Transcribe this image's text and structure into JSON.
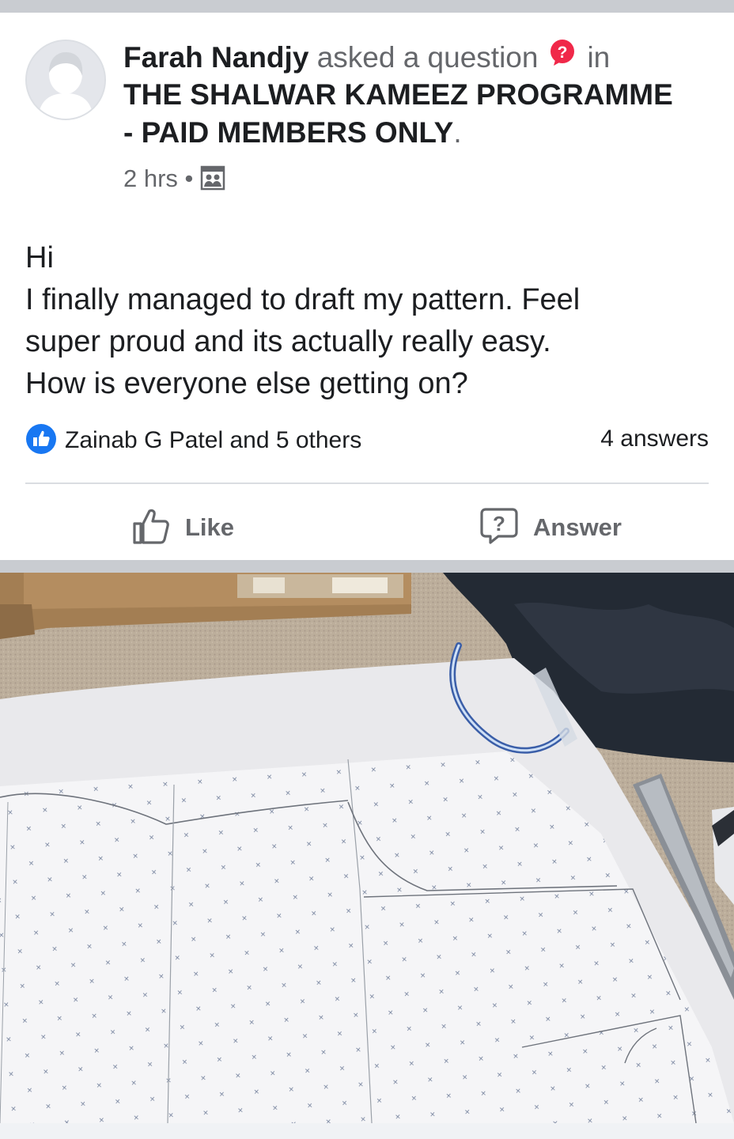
{
  "post": {
    "author": "Farah Nandjy",
    "action_text": "asked a question",
    "in_text": "in",
    "group_line1": "THE SHALWAR KAMEEZ PROGRAMME",
    "group_line2": "- PAID MEMBERS ONLY",
    "group_period": ".",
    "timestamp": "2 hrs",
    "dot": "•",
    "privacy_icon": "group-icon",
    "body_lines": [
      "Hi",
      "I finally managed to draft my pattern. Feel",
      "super proud and its actually really easy.",
      "How is everyone else getting on?"
    ]
  },
  "reactions": {
    "summary": "Zainab G Patel and 5 others",
    "answers": "4 answers"
  },
  "actions": {
    "like_label": "Like",
    "answer_label": "Answer"
  },
  "colors": {
    "question_badge": "#f02849",
    "like_blue": "#1877f2",
    "muted_text": "#65676b"
  }
}
